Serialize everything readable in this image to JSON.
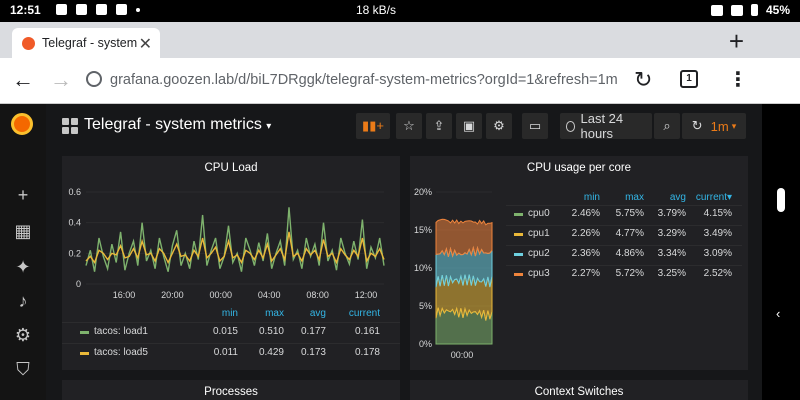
{
  "status": {
    "time": "12:51",
    "speed": "18 kB/s",
    "battery": "45%"
  },
  "browser": {
    "tab_title": "Telegraf - system",
    "url": "grafana.goozen.lab/d/biL7DRggk/telegraf-system-metrics?orgId=1&refresh=1m",
    "tab_count": "1"
  },
  "grafana": {
    "dashboard_title": "Telegraf - system metrics",
    "time_range": "Last 24 hours",
    "refresh": "1m",
    "colors": {
      "green": "#7eb26d",
      "yellow": "#eab839",
      "cyan": "#6ed0e0",
      "orange": "#ef843c",
      "blue_header": "#33b5e5"
    },
    "panels": {
      "cpu_load": {
        "title": "CPU Load",
        "legend_headers": [
          "min",
          "max",
          "avg",
          "current"
        ],
        "rows": [
          {
            "name": "tacos: load1",
            "min": "0.015",
            "max": "0.510",
            "avg": "0.177",
            "current": "0.161"
          },
          {
            "name": "tacos: load5",
            "min": "0.011",
            "max": "0.429",
            "avg": "0.173",
            "current": "0.178"
          }
        ]
      },
      "cpu_per_core": {
        "title": "CPU usage per core",
        "legend_headers": [
          "min",
          "max",
          "avg",
          "current"
        ],
        "rows": [
          {
            "name": "cpu0",
            "min": "2.46%",
            "max": "5.75%",
            "avg": "3.79%",
            "current": "4.15%"
          },
          {
            "name": "cpu1",
            "min": "2.26%",
            "max": "4.77%",
            "avg": "3.29%",
            "current": "3.49%"
          },
          {
            "name": "cpu2",
            "min": "2.36%",
            "max": "4.86%",
            "avg": "3.34%",
            "current": "3.09%"
          },
          {
            "name": "cpu3",
            "min": "2.27%",
            "max": "5.72%",
            "avg": "3.25%",
            "current": "2.52%"
          }
        ]
      },
      "processes": {
        "title": "Processes"
      },
      "context_switches": {
        "title": "Context Switches"
      }
    }
  },
  "chart_data": [
    {
      "type": "line",
      "title": "CPU Load",
      "x_ticks": [
        "16:00",
        "20:00",
        "00:00",
        "04:00",
        "08:00",
        "12:00"
      ],
      "y_ticks": [
        "0",
        "0.2",
        "0.4",
        "0.6"
      ],
      "ylim": [
        0,
        0.6
      ],
      "series": [
        {
          "name": "tacos: load1",
          "color": "#7eb26d",
          "values": [
            0.12,
            0.22,
            0.08,
            0.3,
            0.18,
            0.1,
            0.26,
            0.14,
            0.34,
            0.09,
            0.2,
            0.28,
            0.12,
            0.4,
            0.15,
            0.22,
            0.1,
            0.3,
            0.18,
            0.08,
            0.25,
            0.35,
            0.12,
            0.2,
            0.1,
            0.28,
            0.16,
            0.45,
            0.12,
            0.22,
            0.3,
            0.1,
            0.18,
            0.38,
            0.14,
            0.2,
            0.08,
            0.3,
            0.22,
            0.12,
            0.27,
            0.15,
            0.33,
            0.1,
            0.2,
            0.28,
            0.12,
            0.5,
            0.16,
            0.22,
            0.1,
            0.3,
            0.18,
            0.26,
            0.12,
            0.4,
            0.15,
            0.22,
            0.09,
            0.3,
            0.2,
            0.13,
            0.28,
            0.16,
            0.42,
            0.1,
            0.24,
            0.17,
            0.3,
            0.12
          ]
        },
        {
          "name": "tacos: load5",
          "color": "#eab839",
          "values": [
            0.15,
            0.18,
            0.14,
            0.22,
            0.2,
            0.16,
            0.2,
            0.19,
            0.25,
            0.17,
            0.18,
            0.23,
            0.17,
            0.28,
            0.19,
            0.2,
            0.15,
            0.23,
            0.2,
            0.14,
            0.2,
            0.26,
            0.18,
            0.19,
            0.15,
            0.22,
            0.18,
            0.3,
            0.17,
            0.2,
            0.24,
            0.15,
            0.18,
            0.28,
            0.17,
            0.19,
            0.14,
            0.22,
            0.2,
            0.16,
            0.22,
            0.17,
            0.26,
            0.15,
            0.19,
            0.23,
            0.16,
            0.34,
            0.18,
            0.2,
            0.15,
            0.23,
            0.19,
            0.22,
            0.16,
            0.29,
            0.18,
            0.2,
            0.14,
            0.23,
            0.19,
            0.16,
            0.22,
            0.18,
            0.3,
            0.15,
            0.2,
            0.18,
            0.23,
            0.16
          ]
        }
      ]
    },
    {
      "type": "area",
      "title": "CPU usage per core",
      "x_ticks": [
        "00:00"
      ],
      "y_ticks": [
        "0%",
        "5%",
        "10%",
        "15%",
        "20%"
      ],
      "ylim": [
        0,
        20
      ],
      "stacked": true
    }
  ]
}
